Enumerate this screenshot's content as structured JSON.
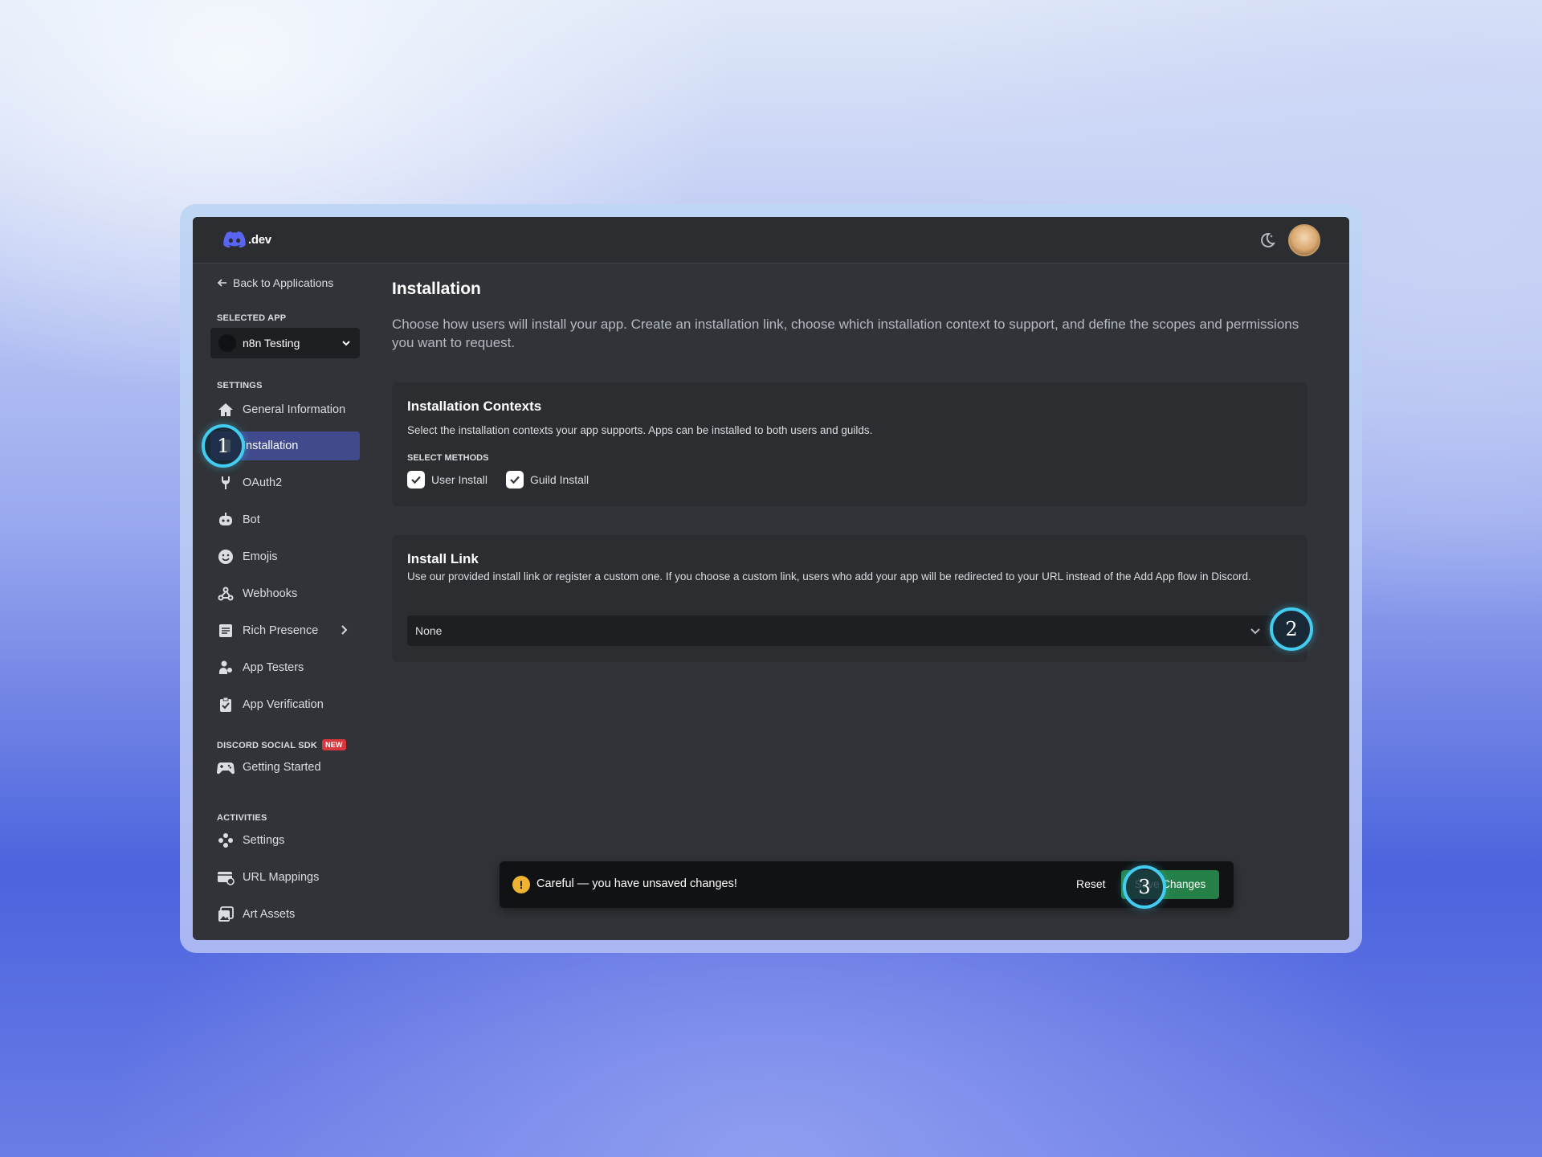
{
  "colors": {
    "accent_blurple": "#5865f2",
    "selection": "#404a8c",
    "save_green": "#248046",
    "warning_yellow": "#f0b232",
    "marker_cyan": "#42cdf0"
  },
  "header": {
    "logo_text": ".dev",
    "theme_icon": "moon-icon",
    "avatar_icon": "user-avatar"
  },
  "sidebar": {
    "back_label": "Back to Applications",
    "selected_app_heading": "SELECTED APP",
    "selected_app": "n8n Testing",
    "settings_heading": "SETTINGS",
    "settings_items": [
      {
        "label": "General Information",
        "icon": "home-icon"
      },
      {
        "label": "Installation",
        "icon": "installation-icon",
        "active": true
      },
      {
        "label": "OAuth2",
        "icon": "wrench-icon"
      },
      {
        "label": "Bot",
        "icon": "robot-icon"
      },
      {
        "label": "Emojis",
        "icon": "emoji-icon"
      },
      {
        "label": "Webhooks",
        "icon": "webhook-icon"
      },
      {
        "label": "Rich Presence",
        "icon": "list-icon"
      },
      {
        "label": "App Testers",
        "icon": "testers-icon"
      },
      {
        "label": "App Verification",
        "icon": "clipboard-check-icon"
      }
    ],
    "sdk_heading": "DISCORD SOCIAL SDK",
    "sdk_badge": "NEW",
    "sdk_items": [
      {
        "label": "Getting Started",
        "icon": "gamepad-icon"
      }
    ],
    "activities_heading": "ACTIVITIES",
    "activities_items": [
      {
        "label": "Settings",
        "icon": "activities-settings-icon"
      },
      {
        "label": "URL Mappings",
        "icon": "url-mapping-icon"
      },
      {
        "label": "Art Assets",
        "icon": "image-icon"
      }
    ]
  },
  "main": {
    "title": "Installation",
    "description": "Choose how users will install your app. Create an installation link, choose which installation context to support, and define the scopes and permissions you want to request.",
    "contexts_card": {
      "title": "Installation Contexts",
      "description": "Select the installation contexts your app supports. Apps can be installed to both users and guilds.",
      "methods_label": "SELECT METHODS",
      "methods": [
        {
          "label": "User Install",
          "checked": true
        },
        {
          "label": "Guild Install",
          "checked": true
        }
      ]
    },
    "link_card": {
      "title": "Install Link",
      "description": "Use our provided install link or register a custom one. If you choose a custom link, users who add your app will be redirected to your URL instead of the Add App flow in Discord.",
      "selected_value": "None"
    }
  },
  "toast": {
    "message": "Careful — you have unsaved changes!",
    "warning_glyph": "!",
    "reset_label": "Reset",
    "save_label": "Save Changes"
  },
  "markers": [
    "1",
    "2",
    "3"
  ]
}
